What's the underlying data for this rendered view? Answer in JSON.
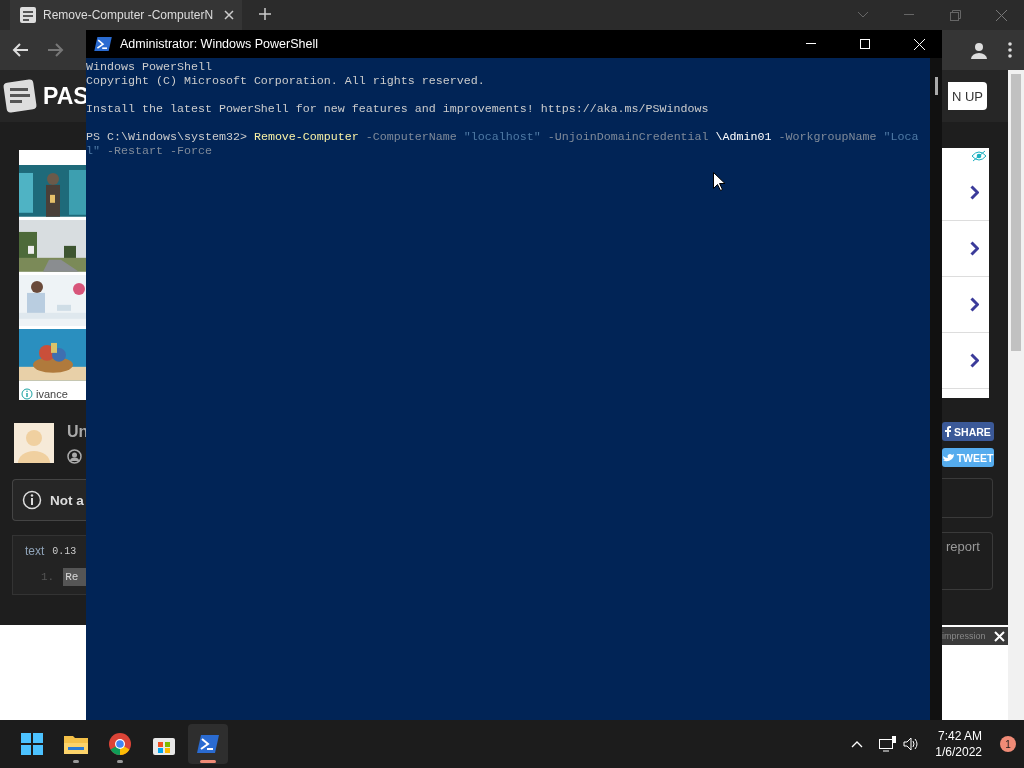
{
  "browser": {
    "tab": {
      "title": "Remove-Computer -ComputerN"
    },
    "page": {
      "logo_text": "PAS",
      "signup_button": "N UP",
      "left_ad": {
        "attribution": "ivance"
      },
      "user": {
        "name": "Un"
      },
      "notice": {
        "text": "Not a"
      },
      "code_box": {
        "language": "text",
        "size": "0.13",
        "line_number": "1.",
        "line_text": "Re"
      },
      "share_buttons": [
        {
          "kind": "facebook",
          "label": "SHARE"
        },
        {
          "kind": "twitter",
          "label": "TWEET"
        }
      ],
      "report_text": "report",
      "ad_banner": {
        "text": "impression"
      }
    }
  },
  "powershell": {
    "title": "Administrator: Windows PowerShell",
    "lines": [
      {
        "kind": "output",
        "tokens": [
          {
            "kind": "text",
            "text": "Windows PowerShell"
          }
        ]
      },
      {
        "kind": "output",
        "tokens": [
          {
            "kind": "text",
            "text": "Copyright (C) Microsoft Corporation. All rights reserved."
          }
        ]
      },
      {
        "kind": "blank"
      },
      {
        "kind": "output",
        "tokens": [
          {
            "kind": "text",
            "text": "Install the latest PowerShell for new features and improvements! https://aka.ms/PSWindows"
          }
        ]
      },
      {
        "kind": "blank"
      },
      {
        "kind": "command",
        "tokens": [
          {
            "kind": "text",
            "text": "PS C:\\Windows\\system32>"
          },
          {
            "kind": "command",
            "text": "Remove-Computer"
          },
          {
            "kind": "parameter",
            "text": "-ComputerName"
          },
          {
            "kind": "string",
            "text": "\"localhost\""
          },
          {
            "kind": "parameter",
            "text": "-UnjoinDomainCredential"
          },
          {
            "kind": "value",
            "text": "\\Admin01"
          },
          {
            "kind": "parameter",
            "text": "-WorkgroupName"
          },
          {
            "kind": "string",
            "text": "\"Loca"
          }
        ]
      },
      {
        "kind": "command",
        "tokens": [
          {
            "kind": "string",
            "text": "l\""
          },
          {
            "kind": "parameter",
            "text": "-Restart"
          },
          {
            "kind": "parameter",
            "text": "-Force"
          }
        ]
      }
    ]
  },
  "taskbar": {
    "apps": [
      {
        "kind": "start",
        "running": false,
        "selected": false
      },
      {
        "kind": "explorer",
        "running": true,
        "selected": false
      },
      {
        "kind": "chrome",
        "running": true,
        "selected": false
      },
      {
        "kind": "store",
        "running": false,
        "selected": false
      },
      {
        "kind": "powershell",
        "running": true,
        "selected": true
      }
    ],
    "time": "7:42 AM",
    "date": "1/6/2022",
    "notifications": "1"
  }
}
